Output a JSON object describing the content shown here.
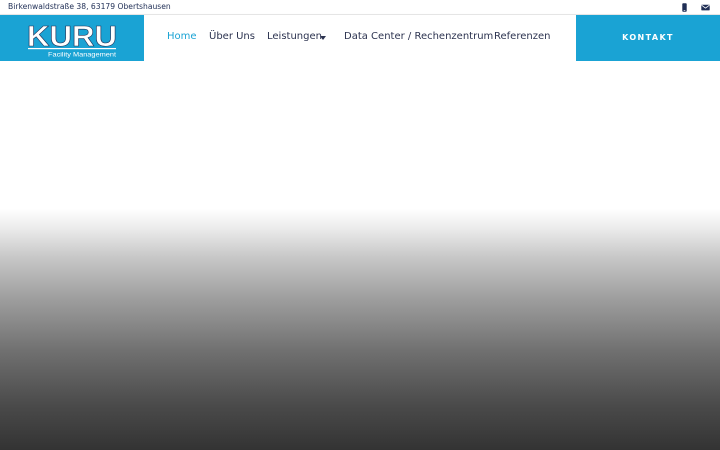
{
  "topbar": {
    "address": "Birkenwaldstraße 38, 63179 Obertshausen",
    "icons": [
      "mobile-phone-icon",
      "envelope-icon"
    ]
  },
  "logo": {
    "text": "KURU",
    "subtitle": "Facility Management"
  },
  "nav": {
    "items": [
      {
        "label": "Home",
        "active": true
      },
      {
        "label": "Über Uns",
        "active": false
      },
      {
        "label": "Leistungen",
        "active": false,
        "has_dropdown": true
      },
      {
        "label": "Data Center / Rechenzentrum",
        "active": false
      },
      {
        "label": "Referenzen",
        "active": false
      }
    ]
  },
  "cta": {
    "label": "KONTAKT"
  },
  "colors": {
    "brand": "#1aa3d4",
    "nav_text": "#2c3350",
    "topbar_text": "#1f2e55",
    "hero_dark": "#333333"
  }
}
